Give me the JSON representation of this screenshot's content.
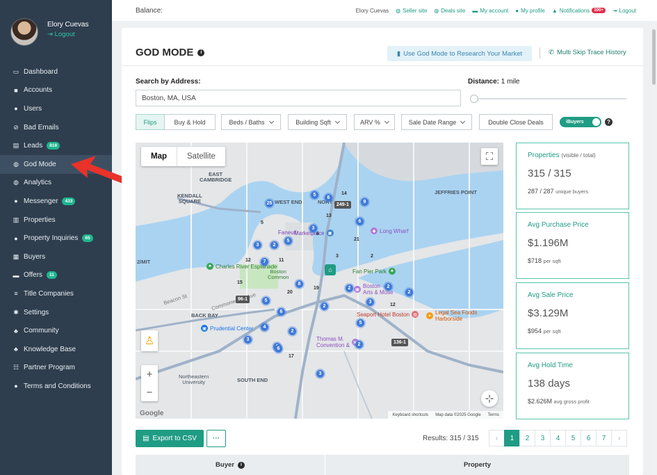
{
  "sidebar": {
    "user_name": "Elory Cuevas",
    "logout": "Logout",
    "items": [
      {
        "label": "Dashboard",
        "icon": "dashboard-icon",
        "glyph": "▭"
      },
      {
        "label": "Accounts",
        "icon": "briefcase-icon",
        "glyph": "■"
      },
      {
        "label": "Users",
        "icon": "user-icon",
        "glyph": "●"
      },
      {
        "label": "Bad Emails",
        "icon": "ban-icon",
        "glyph": "⊘"
      },
      {
        "label": "Leads",
        "icon": "id-card-icon",
        "glyph": "▤",
        "badge": "818"
      },
      {
        "label": "God Mode",
        "icon": "globe-icon",
        "glyph": "◍",
        "active": true
      },
      {
        "label": "Analytics",
        "icon": "globe-icon",
        "glyph": "◍"
      },
      {
        "label": "Messenger",
        "icon": "message-icon",
        "glyph": "●",
        "badge": "433"
      },
      {
        "label": "Properties",
        "icon": "building-icon",
        "glyph": "▥"
      },
      {
        "label": "Property Inquiries",
        "icon": "question-icon",
        "glyph": "●",
        "badge": "65"
      },
      {
        "label": "Buyers",
        "icon": "users-icon",
        "glyph": "▦"
      },
      {
        "label": "Offers",
        "icon": "handshake-icon",
        "glyph": "▬",
        "badge": "11"
      },
      {
        "label": "Title Companies",
        "icon": "list-icon",
        "glyph": "≡"
      },
      {
        "label": "Settings",
        "icon": "gear-icon",
        "glyph": "✱"
      },
      {
        "label": "Community",
        "icon": "community-icon",
        "glyph": "♣"
      },
      {
        "label": "Knowledge Base",
        "icon": "knowledge-icon",
        "glyph": "♣"
      },
      {
        "label": "Partner Program",
        "icon": "partner-icon",
        "glyph": "☷"
      },
      {
        "label": "Terms and Conditions",
        "icon": "info-icon",
        "glyph": "●"
      }
    ]
  },
  "topbar": {
    "balance": "Balance:",
    "user": "Elory Cuevas",
    "seller_site": "Seller site",
    "deals_site": "Deals site",
    "my_account": "My account",
    "my_profile": "My profile",
    "notifications": "Notifications",
    "notif_badge": "100+",
    "logout": "Logout"
  },
  "header": {
    "title": "GOD MODE",
    "research_button": "Use God Mode to Research Your Market",
    "skip_trace": "Multi Skip Trace History"
  },
  "search": {
    "address_label": "Search by Address:",
    "address_value": "Boston, MA, USA",
    "distance_label": "Distance:",
    "distance_value": "1 mile",
    "distance_level": 0
  },
  "filters": {
    "flips": "Flips",
    "buy_hold": "Buy & Hold",
    "beds_baths": "Beds / Baths",
    "building_sqft": "Building Sqft",
    "arv": "ARV %",
    "sale_date": "Sale Date Range",
    "double_close": "Double Close Deals",
    "ibuyers": "iBuyers",
    "ibuyers_on": true
  },
  "map": {
    "tab_map": "Map",
    "tab_satellite": "Satellite",
    "places": {
      "east_cambridge": "EAST\nCAMBRIDGE",
      "kendall": "KENDALL\nSQUARE",
      "west_end": "WEST END",
      "north_end": "NORT",
      "jeffries": "JEFFRIES POINT",
      "mit": "2/MIT",
      "back_bay": "BACK BAY",
      "south_end": "SOUTH END",
      "northeastern": "Northeastern\nUniversity",
      "boston_common": "Boston\nCommon",
      "faneuil": "Faneuil",
      "marketplace": "Marketplace",
      "long_wharf": "Long Wharf",
      "esplanade": "Charles River Esplanade",
      "fan_pier": "Fan Pier Park",
      "ica": "Boston\nArts & Muse",
      "seaport": "Seaport Hotel Boston",
      "legal": "Legal Sea Foods\nHarborside",
      "prudential": "Prudential Center",
      "convention": "Thomas M.\nConvention &",
      "beacon": "Beacon St",
      "commonwealth": "Commonwealth Ave"
    },
    "clusters": [
      "5",
      "6",
      "9",
      "25",
      "3",
      "6",
      "3",
      "2",
      "5",
      "7",
      "8",
      "2",
      "2",
      "2",
      "3",
      "2",
      "5",
      "6",
      "5",
      "4",
      "2",
      "3",
      "5",
      "2",
      "3",
      "6",
      "2",
      "2",
      "8"
    ],
    "markers": [
      "249-1",
      "96-1",
      "136-1"
    ],
    "numbers": [
      "14",
      "13",
      "12",
      "11",
      "15",
      "20",
      "19",
      "21",
      "12",
      "17",
      "6",
      "5",
      "3",
      "2"
    ],
    "footer": [
      "Keyboard shortcuts",
      "Map data ©2025 Google",
      "Terms"
    ],
    "google": "Google"
  },
  "stats": [
    {
      "label": "Properties",
      "label_note": "(visible / total)",
      "value": "315 / 315",
      "sub": "287 / 287",
      "sub_note": "unique buyers"
    },
    {
      "label": "Avg Purchase Price",
      "label_note": "",
      "value": "$1.196M",
      "sub": "$718",
      "sub_note": "per sqft"
    },
    {
      "label": "Avg Sale Price",
      "label_note": "",
      "value": "$3.129M",
      "sub": "$954",
      "sub_note": "per sqft"
    },
    {
      "label": "Avg Hold Time",
      "label_note": "",
      "value": "138 days",
      "sub": "$2.626M",
      "sub_note": "avg gross profit"
    }
  ],
  "table": {
    "export": "Export to CSV",
    "more": "···",
    "results": "Results: 315 / 315",
    "pages": [
      "‹",
      "1",
      "2",
      "3",
      "4",
      "5",
      "6",
      "7",
      "›"
    ],
    "current_page": "1",
    "col_buyer": "Buyer",
    "col_property": "Property"
  },
  "colors": {
    "accent": "#1f9c84",
    "sidebar": "#2e3e4e",
    "cluster": "#3e79d9",
    "arrow": "#e8322a"
  }
}
